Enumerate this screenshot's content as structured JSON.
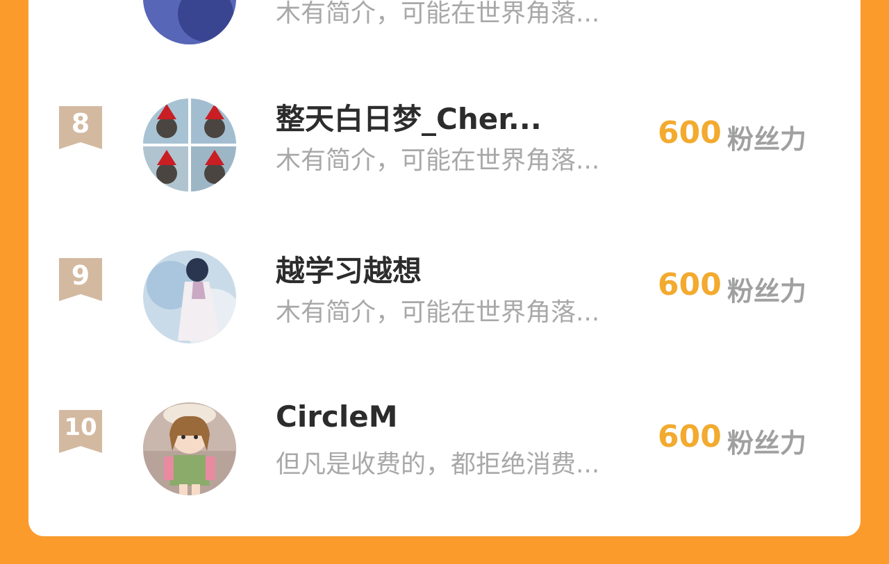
{
  "colors": {
    "page_background": "#fb9b2c",
    "card_background": "#ffffff",
    "rank_badge": "#d3b9a0",
    "score": "#f2aa2f",
    "name": "#2c2c2c",
    "bio": "#a8a8a8",
    "unit": "#a0a0a0"
  },
  "previous_row": {
    "bio": "木有简介，可能在世界角落..."
  },
  "rows": [
    {
      "rank": "8",
      "name": "整天白日梦_Cher...",
      "bio": "木有简介，可能在世界角落...",
      "score": "600",
      "unit": "粉丝力",
      "avatar_icon": "cat-in-santa-hat-avatar"
    },
    {
      "rank": "9",
      "name": "越学习越想",
      "bio": "木有简介，可能在世界角落...",
      "score": "600",
      "unit": "粉丝力",
      "avatar_icon": "illustrated-girl-avatar"
    },
    {
      "rank": "10",
      "name": "CircleM",
      "bio": "但凡是收费的，都拒绝消费...",
      "score": "600",
      "unit": "粉丝力",
      "avatar_icon": "doll-avatar"
    }
  ]
}
